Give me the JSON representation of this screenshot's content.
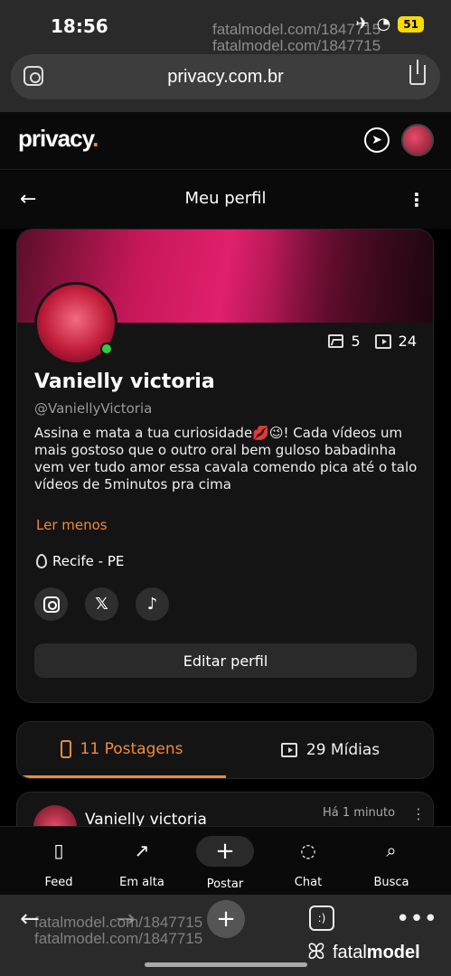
{
  "status": {
    "time": "18:56",
    "battery": "51"
  },
  "watermark": {
    "line1": "fatalmodel.com/1847715",
    "line2": "fatalmodel.com/1847715"
  },
  "browser": {
    "url": "privacy.com.br"
  },
  "app": {
    "logo": "privacy",
    "logo_dot": "."
  },
  "subheader": {
    "title": "Meu perfil"
  },
  "profile": {
    "name": "Vanielly victoria",
    "handle": "@VaniellyVictoria",
    "bio": "Assina e mata a tua curiosidade💋😉! Cada vídeos um mais gostoso que o outro oral bem guloso babadinha vem ver tudo amor essa cavala comendo pica até o talo vídeos de 5minutos pra cima",
    "read_less": "Ler menos",
    "location": "Recife - PE",
    "photos_count": "5",
    "videos_count": "24",
    "edit_label": "Editar perfil",
    "socials": [
      {
        "name": "instagram-icon",
        "glyph": ""
      },
      {
        "name": "x-icon",
        "glyph": "𝕏"
      },
      {
        "name": "tiktok-icon",
        "glyph": "♪"
      }
    ]
  },
  "tabs": {
    "posts": "11 Postagens",
    "media": "29 Mídias"
  },
  "post": {
    "author": "Vanielly victoria",
    "time": "Há 1 minuto"
  },
  "nav": {
    "feed": "Feed",
    "trending": "Em alta",
    "post": "Postar",
    "chat": "Chat",
    "search": "Busca"
  },
  "footer": {
    "brand_light": "fatal",
    "brand_bold": "model"
  },
  "colors": {
    "accent": "#f08a3c",
    "background": "#0a0a0a",
    "card": "#141414",
    "online": "#2ecc40"
  }
}
